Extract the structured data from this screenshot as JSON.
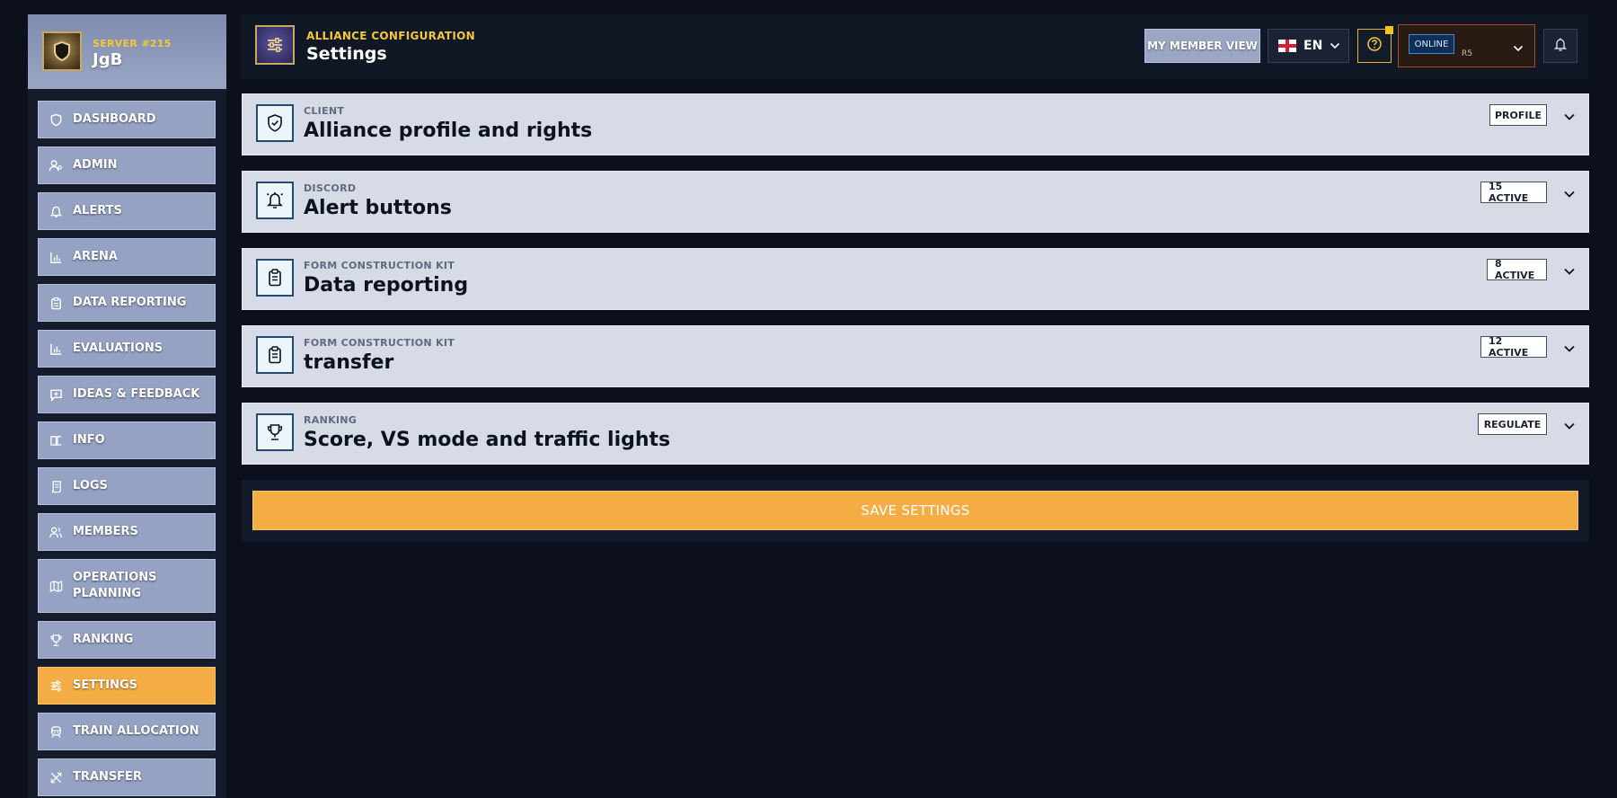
{
  "server": {
    "label": "SERVER #215",
    "name": "JgB"
  },
  "nav": [
    {
      "label": "DASHBOARD",
      "icon": "shield-icon"
    },
    {
      "label": "ADMIN",
      "icon": "user-admin-icon"
    },
    {
      "label": "ALERTS",
      "icon": "bell-icon"
    },
    {
      "label": "ARENA",
      "icon": "bar-chart-icon"
    },
    {
      "label": "DATA REPORTING",
      "icon": "clipboard-icon"
    },
    {
      "label": "EVALUATIONS",
      "icon": "bar-chart-icon"
    },
    {
      "label": "IDEAS & FEEDBACK",
      "icon": "message-plus-icon"
    },
    {
      "label": "INFO",
      "icon": "book-icon"
    },
    {
      "label": "LOGS",
      "icon": "scroll-icon"
    },
    {
      "label": "MEMBERS",
      "icon": "users-icon"
    },
    {
      "label": "OPERATIONS PLANNING",
      "icon": "map-icon"
    },
    {
      "label": "RANKING",
      "icon": "trophy-icon"
    },
    {
      "label": "SETTINGS",
      "icon": "sliders-icon",
      "active": true
    },
    {
      "label": "TRAIN ALLOCATION",
      "icon": "train-icon"
    },
    {
      "label": "TRANSFER",
      "icon": "transfer-icon"
    }
  ],
  "header": {
    "subtitle": "ALLIANCE CONFIGURATION",
    "title": "Settings",
    "member_view": "MY MEMBER VIEW",
    "language": "EN",
    "status": "ONLINE",
    "rank": "R5"
  },
  "cards": [
    {
      "category": "CLIENT",
      "title": "Alliance profile and rights",
      "badge": "PROFILE",
      "icon": "shield-check-icon"
    },
    {
      "category": "DISCORD",
      "title": "Alert buttons",
      "badge": "15 ACTIVE",
      "icon": "bell-icon"
    },
    {
      "category": "FORM CONSTRUCTION KIT",
      "title": "Data reporting",
      "badge": "8 ACTIVE",
      "icon": "clipboard-icon"
    },
    {
      "category": "FORM CONSTRUCTION KIT",
      "title": "transfer",
      "badge": "12 ACTIVE",
      "icon": "clipboard-icon"
    },
    {
      "category": "RANKING",
      "title": "Score, VS mode and traffic lights",
      "badge": "REGULATE",
      "icon": "trophy-icon"
    }
  ],
  "save_label": "SAVE SETTINGS",
  "colors": {
    "accent": "#f4ad45",
    "nav_bg": "#95a2c4",
    "gold": "#f3c63d",
    "page_bg": "#0b101c"
  }
}
